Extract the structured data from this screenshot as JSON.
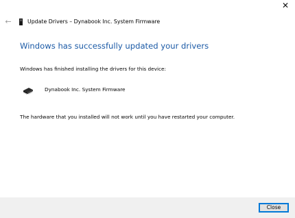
{
  "window": {
    "close_glyph": "✕",
    "back_glyph": "←",
    "title": "Update Drivers – Dynabook Inc. System Firmware"
  },
  "content": {
    "heading": "Windows has successfully updated your drivers",
    "finished_text": "Windows has finished installing the drivers for this device:",
    "device_name": "Dynabook Inc. System Firmware",
    "restart_notice": "The hardware that you installed will not work until you have restarted your computer."
  },
  "footer": {
    "close_label": "Close"
  },
  "icons": {
    "title_icon": "device-icon",
    "device_icon": "chip-icon"
  },
  "colors": {
    "heading": "#1b5aa6",
    "footer_bg": "#f0f0f0",
    "button_border": "#0078d7"
  }
}
